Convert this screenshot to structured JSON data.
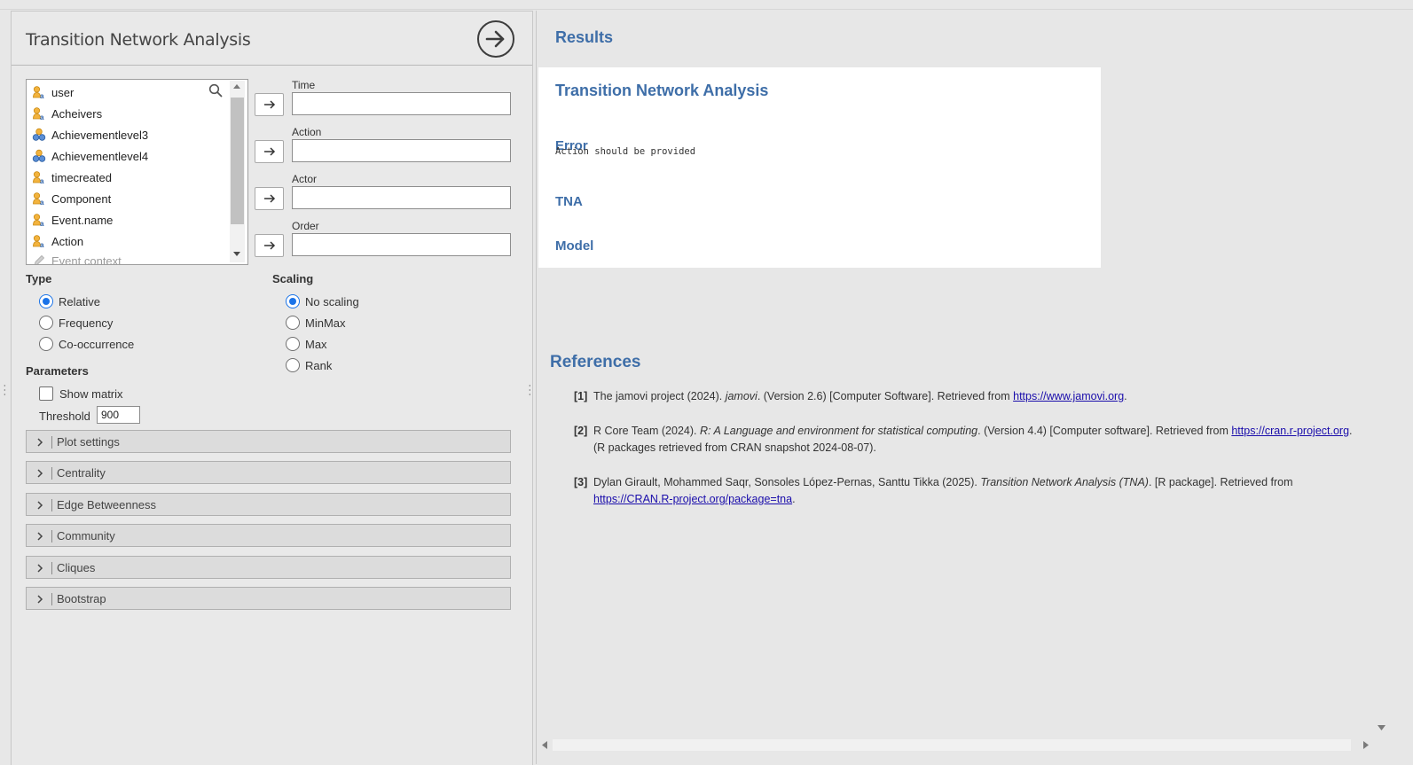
{
  "analysis": {
    "title": "Transition Network Analysis"
  },
  "variables": [
    {
      "name": "user",
      "kind": "nominal"
    },
    {
      "name": "Acheivers",
      "kind": "nominal"
    },
    {
      "name": "Achievementlevel3",
      "kind": "nominal-multi"
    },
    {
      "name": "Achievementlevel4",
      "kind": "nominal-multi"
    },
    {
      "name": "timecreated",
      "kind": "nominal"
    },
    {
      "name": "Component",
      "kind": "nominal"
    },
    {
      "name": "Event.name",
      "kind": "nominal"
    },
    {
      "name": "Action",
      "kind": "nominal"
    },
    {
      "name": "Event context",
      "kind": "disabled"
    }
  ],
  "targets": {
    "time_label": "Time",
    "action_label": "Action",
    "actor_label": "Actor",
    "order_label": "Order"
  },
  "type": {
    "heading": "Type",
    "options": [
      "Relative",
      "Frequency",
      "Co-occurrence"
    ],
    "selected": "Relative"
  },
  "scaling": {
    "heading": "Scaling",
    "options": [
      "No scaling",
      "MinMax",
      "Max",
      "Rank"
    ],
    "selected": "No scaling"
  },
  "parameters": {
    "heading": "Parameters",
    "show_matrix_label": "Show matrix",
    "show_matrix_checked": false,
    "threshold_label": "Threshold",
    "threshold_value": "900"
  },
  "sections": [
    "Plot settings",
    "Centrality",
    "Edge Betweenness",
    "Community",
    "Cliques",
    "Bootstrap"
  ],
  "results": {
    "heading": "Results",
    "card_title": "Transition Network Analysis",
    "error_heading": "Error",
    "error_message": "Action should be provided",
    "tna_heading": "TNA",
    "model_heading": "Model"
  },
  "references": {
    "heading": "References",
    "items": [
      {
        "num": "[1]",
        "pre": "The jamovi project (2024). ",
        "italic": "jamovi",
        "post": ". (Version 2.6) [Computer Software]. Retrieved from ",
        "link": "https://www.jamovi.org",
        "tail": "."
      },
      {
        "num": "[2]",
        "pre": "R Core Team (2024). ",
        "italic": "R: A Language and environment for statistical computing",
        "post": ". (Version 4.4) [Computer software]. Retrieved from ",
        "link": "https://cran.r-project.org",
        "tail": ". (R packages retrieved from CRAN snapshot 2024-08-07)."
      },
      {
        "num": "[3]",
        "pre": "Dylan Girault, Mohammed Saqr, Sonsoles López-Pernas, Santtu Tikka (2025). ",
        "italic": "Transition Network Analysis (TNA)",
        "post": ". [R package]. Retrieved from ",
        "link": "https://CRAN.R-project.org/package=tna",
        "tail": "."
      }
    ]
  },
  "colors": {
    "accent": "#3e6ea8",
    "radio_selected": "#1a73e8",
    "link": "#1a0dab"
  }
}
